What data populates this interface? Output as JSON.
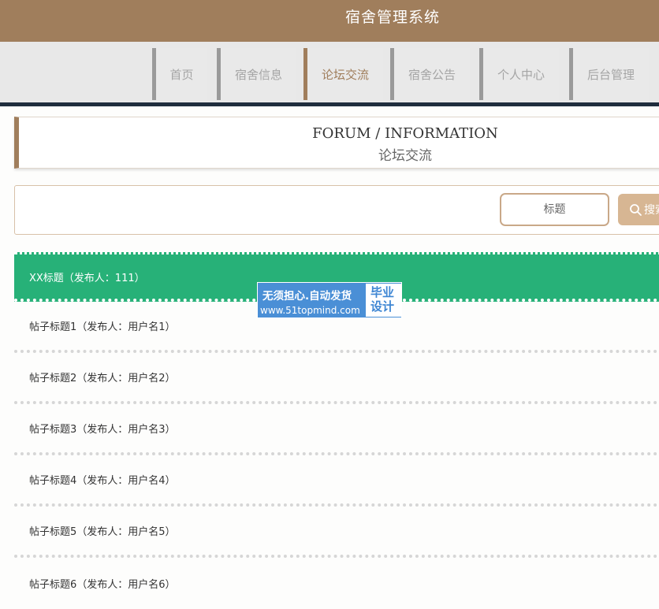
{
  "header": {
    "site_title": "宿舍管理系统"
  },
  "nav": {
    "items": [
      {
        "label": "首页"
      },
      {
        "label": "宿舍信息"
      },
      {
        "label": "论坛交流"
      },
      {
        "label": "宿舍公告"
      },
      {
        "label": "个人中心"
      },
      {
        "label": "后台管理"
      }
    ],
    "active_index": 2
  },
  "section": {
    "title_en": "FORUM / INFORMATION",
    "title_zh": "论坛交流"
  },
  "search": {
    "placeholder": "标题",
    "button_label": "搜索"
  },
  "posts": [
    {
      "label": "XX标题（发布人：111）"
    },
    {
      "label": "帖子标题1（发布人：用户名1）"
    },
    {
      "label": "帖子标题2（发布人：用户名2）"
    },
    {
      "label": "帖子标题3（发布人：用户名3）"
    },
    {
      "label": "帖子标题4（发布人：用户名4）"
    },
    {
      "label": "帖子标题5（发布人：用户名5）"
    },
    {
      "label": "帖子标题6（发布人：用户名6）"
    }
  ],
  "watermark": {
    "line1": "无须担心.自动发货",
    "line2": "www.51topmind.com",
    "box_line1": "毕业",
    "box_line2": "设计"
  },
  "colors": {
    "brand": "#a07e5c",
    "highlight_row": "#27b178",
    "search_button": "#d7b693",
    "nav_bottom_line": "#1f2d3d"
  },
  "icons": {
    "search": "search-icon"
  }
}
